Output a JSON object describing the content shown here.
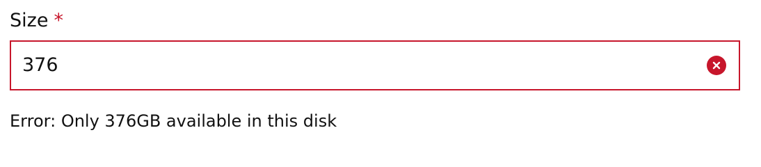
{
  "field": {
    "label": "Size",
    "required_mark": "*",
    "value": "376",
    "error_prefix": "Error:",
    "error_message": "Only 376GB available in this disk"
  },
  "icons": {
    "error": "x-circle-icon"
  },
  "colors": {
    "error": "#c7162b",
    "text": "#111111",
    "background": "#ffffff"
  }
}
